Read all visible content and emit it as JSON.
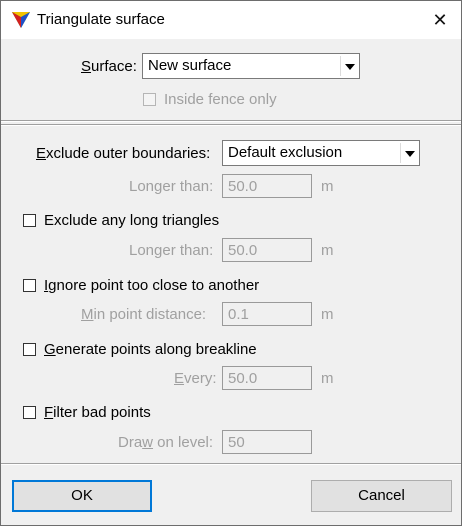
{
  "window": {
    "title": "Triangulate surface"
  },
  "surface": {
    "label_prefix": "",
    "label_mnemonic": "S",
    "label_rest": "urface:",
    "value": "New surface",
    "inside_fence": {
      "label": "Inside fence only",
      "checked": false,
      "enabled": false
    }
  },
  "exclude_outer": {
    "label_mnemonic": "E",
    "label_rest": "xclude outer boundaries:",
    "value": "Default exclusion",
    "longer_than": {
      "label": "Longer than:",
      "value": "50.0",
      "unit": "m"
    }
  },
  "exclude_long": {
    "label": "Exclude any long triangles",
    "checked": false,
    "longer_than": {
      "label": "Longer than:",
      "value": "50.0",
      "unit": "m"
    }
  },
  "ignore_close": {
    "label_mnemonic": "I",
    "label_rest": "gnore point too close to another",
    "checked": false,
    "min_distance": {
      "label_mnemonic": "M",
      "label_rest": "in point distance:",
      "value": "0.1",
      "unit": "m"
    }
  },
  "generate_breakline": {
    "label_mnemonic": "G",
    "label_rest": "enerate points along breakline",
    "checked": false,
    "every": {
      "label_mnemonic": "E",
      "label_rest": "very:",
      "value": "50.0",
      "unit": "m"
    }
  },
  "filter_bad": {
    "label_mnemonic": "F",
    "label_rest": "ilter bad points",
    "checked": false,
    "draw_level": {
      "label_prefix": "Dra",
      "label_mnemonic": "w",
      "label_rest": " on level:",
      "value": "50"
    }
  },
  "buttons": {
    "ok": "OK",
    "cancel": "Cancel"
  },
  "icons": {
    "app": "triangle-surface-icon",
    "close": "close-icon",
    "dropdown": "chevron-down-icon"
  }
}
